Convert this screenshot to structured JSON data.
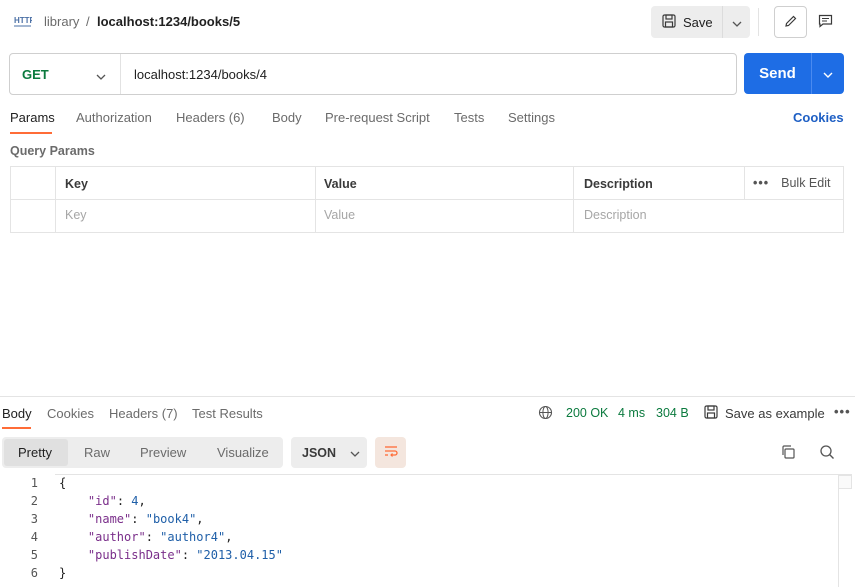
{
  "header": {
    "breadcrumb_parent": "library",
    "breadcrumb_sep": "/",
    "breadcrumb_current": "localhost:1234/books/5",
    "save_label": "Save"
  },
  "request": {
    "method": "GET",
    "url": "localhost:1234/books/4",
    "send_label": "Send"
  },
  "request_tabs": [
    "Params",
    "Authorization",
    "Headers (6)",
    "Body",
    "Pre-request Script",
    "Tests",
    "Settings"
  ],
  "cookies_label": "Cookies",
  "query_params": {
    "title": "Query Params",
    "columns": [
      "Key",
      "Value",
      "Description"
    ],
    "bulk_edit": "Bulk Edit",
    "more": "•••",
    "placeholders": {
      "key": "Key",
      "value": "Value",
      "description": "Description"
    }
  },
  "response": {
    "tabs": [
      "Body",
      "Cookies",
      "Headers (7)",
      "Test Results"
    ],
    "status": "200 OK",
    "time": "4 ms",
    "size": "304 B",
    "save_example": "Save as example",
    "more": "•••",
    "view_options": [
      "Pretty",
      "Raw",
      "Preview",
      "Visualize"
    ],
    "format": "JSON",
    "line_numbers": [
      "1",
      "2",
      "3",
      "4",
      "5",
      "6"
    ],
    "json": {
      "open": "{",
      "close": "}",
      "fields": [
        {
          "key": "\"id\"",
          "value": "4",
          "type": "number",
          "comma": ","
        },
        {
          "key": "\"name\"",
          "value": "\"book4\"",
          "type": "string",
          "comma": ","
        },
        {
          "key": "\"author\"",
          "value": "\"author4\"",
          "type": "string",
          "comma": ","
        },
        {
          "key": "\"publishDate\"",
          "value": "\"2013.04.15\"",
          "type": "string",
          "comma": ""
        }
      ]
    }
  },
  "colors": {
    "accent_orange": "#ff6c37",
    "send_blue": "#1e6de5",
    "status_green": "#0b7a3e",
    "link_blue": "#1e5fc4"
  }
}
